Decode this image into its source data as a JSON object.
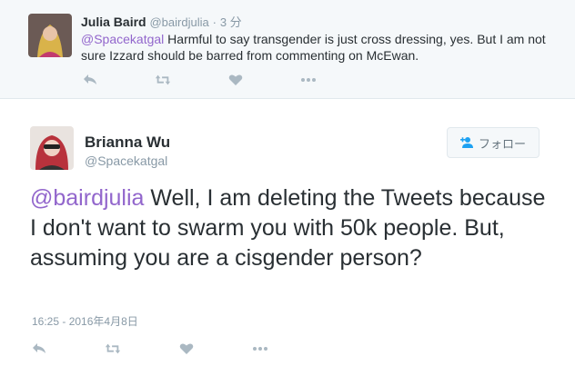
{
  "parent_tweet": {
    "name": "Julia Baird",
    "handle": "@bairdjulia",
    "separator": "·",
    "time": "3 分",
    "mention": "@Spacekatgal",
    "text": " Harmful to say transgender is just cross dressing, yes. But I am not sure Izzard should be barred from commenting on McEwan.",
    "actions": {
      "reply": "reply-icon",
      "retweet": "retweet-icon",
      "like": "heart-icon",
      "more": "more-icon"
    }
  },
  "main_tweet": {
    "name": "Brianna Wu",
    "handle": "@Spacekatgal",
    "follow_label": "フォロー",
    "mention": "@bairdjulia",
    "text": " Well, I am deleting the Tweets because I don't want to swarm you with 50k people. But, assuming you are a cisgender person?",
    "timestamp": "16:25 - 2016年4月8日",
    "actions": {
      "reply": "reply-icon",
      "retweet": "retweet-icon",
      "like": "heart-icon",
      "more": "more-icon"
    }
  },
  "colors": {
    "mention": "#9266cc",
    "secondary_text": "#8899a6",
    "action_icon": "#aab8c2",
    "parent_background": "#f5f8fa"
  }
}
